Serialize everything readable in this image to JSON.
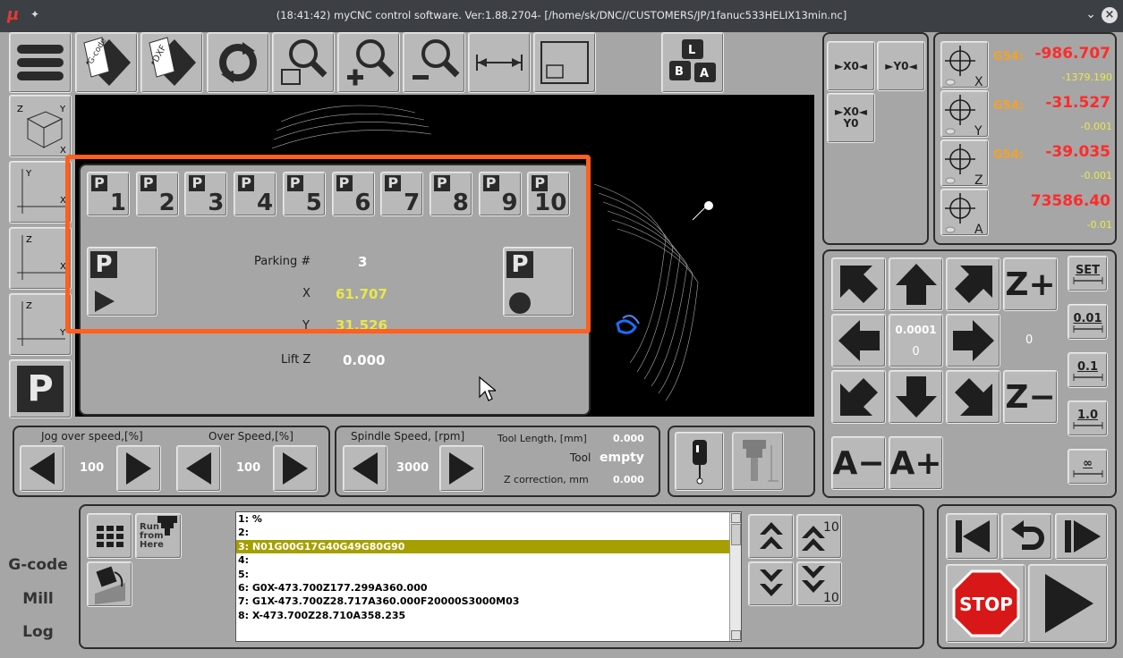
{
  "window": {
    "title": "(18:41:42) myCNC control software. Ver:1.88.2704- [/home/sk/DNC//CUSTOMERS/JP/1fanuc533HELIX13min.nc]",
    "logo": "µ",
    "pin": "✦",
    "chevron": "⌄",
    "close": "×"
  },
  "toolbar": {
    "gcode_label": "G-code",
    "dxf_label": "DXF",
    "keys": [
      "L",
      "B",
      "A"
    ]
  },
  "parking": {
    "buttons": [
      {
        "p": "P",
        "num": "1"
      },
      {
        "p": "P",
        "num": "2"
      },
      {
        "p": "P",
        "num": "3"
      },
      {
        "p": "P",
        "num": "4"
      },
      {
        "p": "P",
        "num": "5"
      },
      {
        "p": "P",
        "num": "6"
      },
      {
        "p": "P",
        "num": "7"
      },
      {
        "p": "P",
        "num": "8"
      },
      {
        "p": "P",
        "num": "9"
      },
      {
        "p": "P",
        "num": "10"
      }
    ],
    "parking_label": "Parking #",
    "parking_value": "3",
    "x_label": "X",
    "x_value": "61.707",
    "y_label": "Y",
    "y_value": "31.526",
    "liftz_label": "Lift Z",
    "liftz_value": "0.000",
    "go_p": "P",
    "set_p": "P"
  },
  "left_tools": {
    "z": "Z",
    "y": "Y",
    "x": "X",
    "p": "P"
  },
  "zero_buttons": {
    "x0": "►X0◄",
    "y0": "►Y0◄",
    "xy0_line1": "►X0◄",
    "xy0_line2": "Y0"
  },
  "dro": [
    {
      "axis": "X",
      "coord": "G54:",
      "value": "-986.707",
      "sub": "-1379.190"
    },
    {
      "axis": "Y",
      "coord": "G54:",
      "value": "-31.527",
      "sub": "-0.001"
    },
    {
      "axis": "Z",
      "coord": "G54:",
      "value": "-39.035",
      "sub": "-0.001"
    },
    {
      "axis": "A",
      "coord": "",
      "value": "73586.40",
      "sub": "-0.01"
    }
  ],
  "jog": {
    "zplus": "Z+",
    "zminus": "Z−",
    "aminus": "A−",
    "aplus": "A+",
    "step_value": "0.0001",
    "step_sub": "0",
    "right_value": "0",
    "steps": [
      "SET",
      "0.01",
      "0.1",
      "1.0",
      "∞"
    ]
  },
  "speeds": {
    "jog_label": "Jog over speed,[%]",
    "jog_value": "100",
    "over_label": "Over Speed,[%]",
    "over_value": "100",
    "spindle_label": "Spindle Speed, [rpm]",
    "spindle_value": "3000",
    "tool_length_label": "Tool Length, [mm]",
    "tool_length_value": "0.000",
    "tool_label": "Tool",
    "tool_value": "empty",
    "zcorr_label": "Z correction, mm",
    "zcorr_value": "0.000"
  },
  "bottom": {
    "tabs": [
      "G-code",
      "Mill",
      "Log"
    ],
    "run_from_here": [
      "Run",
      "from",
      "Here"
    ],
    "stop": "STOP",
    "page_up_count": "10",
    "page_down_count": "10"
  },
  "gcode_lines": [
    "1: %",
    "2:",
    "3: N01G00G17G40G49G80G90",
    "4:",
    "5:",
    "6: G0X-473.700Z177.299A360.000",
    "7: G1X-473.700Z28.717A360.000F20000S3000M03",
    "8: X-473.700Z28.710A358.235"
  ],
  "colors": {
    "highlight": "#ff5f1f",
    "selected_line": "#a5a000",
    "dro_red": "#ff2b2b",
    "dro_yellow": "#e9e94a",
    "coord_orange": "#f3a12a"
  }
}
